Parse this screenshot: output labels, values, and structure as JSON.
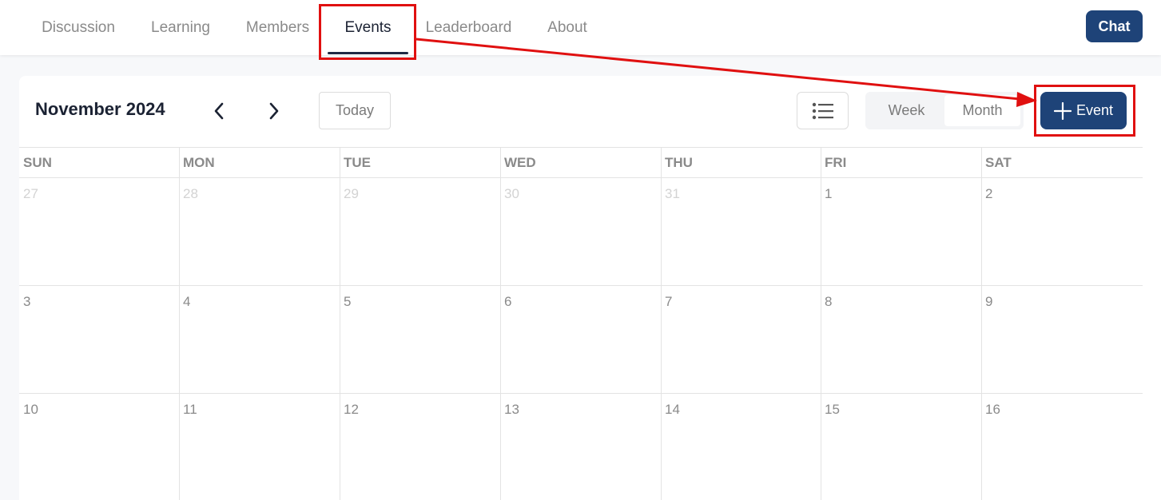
{
  "nav": {
    "tabs": [
      {
        "label": "Discussion"
      },
      {
        "label": "Learning"
      },
      {
        "label": "Members"
      },
      {
        "label": "Events",
        "active": true
      },
      {
        "label": "Leaderboard"
      },
      {
        "label": "About"
      }
    ],
    "chat_label": "Chat"
  },
  "calendar": {
    "month_title": "November 2024",
    "today_label": "Today",
    "view_options": [
      "Week",
      "Month"
    ],
    "selected_view": "Month",
    "add_event_label": "Event",
    "weekdays": [
      "SUN",
      "MON",
      "TUE",
      "WED",
      "THU",
      "FRI",
      "SAT"
    ],
    "weeks": [
      [
        {
          "day": "27",
          "outside_month": true
        },
        {
          "day": "28",
          "outside_month": true
        },
        {
          "day": "29",
          "outside_month": true
        },
        {
          "day": "30",
          "outside_month": true
        },
        {
          "day": "31",
          "outside_month": true
        },
        {
          "day": "1"
        },
        {
          "day": "2"
        }
      ],
      [
        {
          "day": "3"
        },
        {
          "day": "4"
        },
        {
          "day": "5"
        },
        {
          "day": "6"
        },
        {
          "day": "7"
        },
        {
          "day": "8"
        },
        {
          "day": "9"
        }
      ],
      [
        {
          "day": "10"
        },
        {
          "day": "11"
        },
        {
          "day": "12"
        },
        {
          "day": "13"
        },
        {
          "day": "14"
        },
        {
          "day": "15"
        },
        {
          "day": "16"
        }
      ]
    ]
  },
  "icons": {
    "prev": "chevron-left-icon",
    "next": "chevron-right-icon",
    "list": "list-icon",
    "plus": "plus-icon"
  },
  "colors": {
    "primary": "#1e4378",
    "annotation": "#e01010",
    "muted_text": "#8a8a8a",
    "faded_text": "#d3d3d3"
  }
}
